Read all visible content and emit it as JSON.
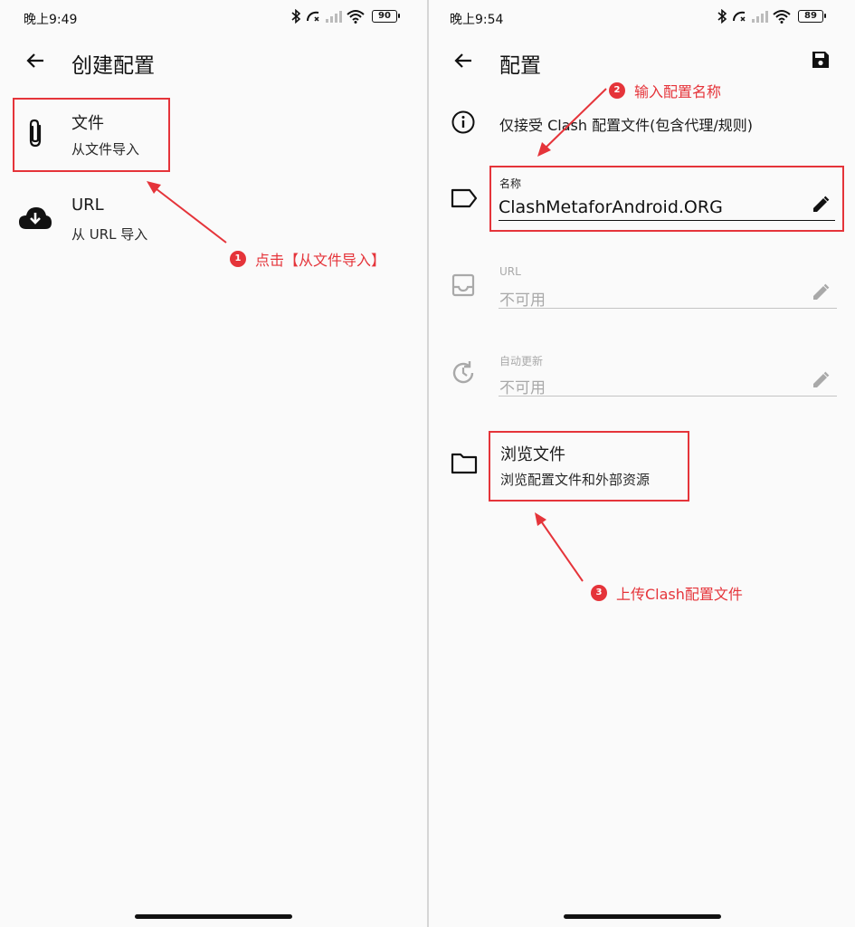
{
  "left": {
    "status": {
      "time": "晚上9:49",
      "battery": "90"
    },
    "appbar": {
      "back_icon": "arrow-left-icon",
      "title": "创建配置"
    },
    "items": [
      {
        "icon": "paperclip-icon",
        "title": "文件",
        "subtitle": "从文件导入"
      },
      {
        "icon": "cloud-download-icon",
        "title": "URL",
        "subtitle": "从 URL 导入"
      }
    ],
    "annotation": {
      "number": "1",
      "text": "点击【从文件导入】",
      "color": "#e5343a"
    }
  },
  "right": {
    "status": {
      "time": "晚上9:54",
      "battery": "89"
    },
    "appbar": {
      "back_icon": "arrow-left-icon",
      "title": "配置",
      "save_icon": "save-icon"
    },
    "info": {
      "icon": "info-icon",
      "text": "仅接受 Clash 配置文件(包含代理/规则)"
    },
    "fields": {
      "name": {
        "icon": "label-icon",
        "label": "名称",
        "value": "ClashMetaforAndroid.ORG",
        "edit_icon": "pencil-icon"
      },
      "url": {
        "icon": "inbox-icon",
        "label": "URL",
        "value": "不可用",
        "edit_icon": "pencil-icon"
      },
      "auto_update": {
        "icon": "update-icon",
        "label": "自动更新",
        "value": "不可用",
        "edit_icon": "pencil-icon"
      }
    },
    "browse": {
      "icon": "folder-icon",
      "title": "浏览文件",
      "subtitle": "浏览配置文件和外部资源"
    },
    "annotations": [
      {
        "number": "2",
        "text": "输入配置名称"
      },
      {
        "number": "3",
        "text": "上传Clash配置文件"
      }
    ]
  },
  "colors": {
    "accent_red": "#e5343a",
    "disabled_gray": "#a9a9a9",
    "text_dark": "#1b1b1b"
  }
}
